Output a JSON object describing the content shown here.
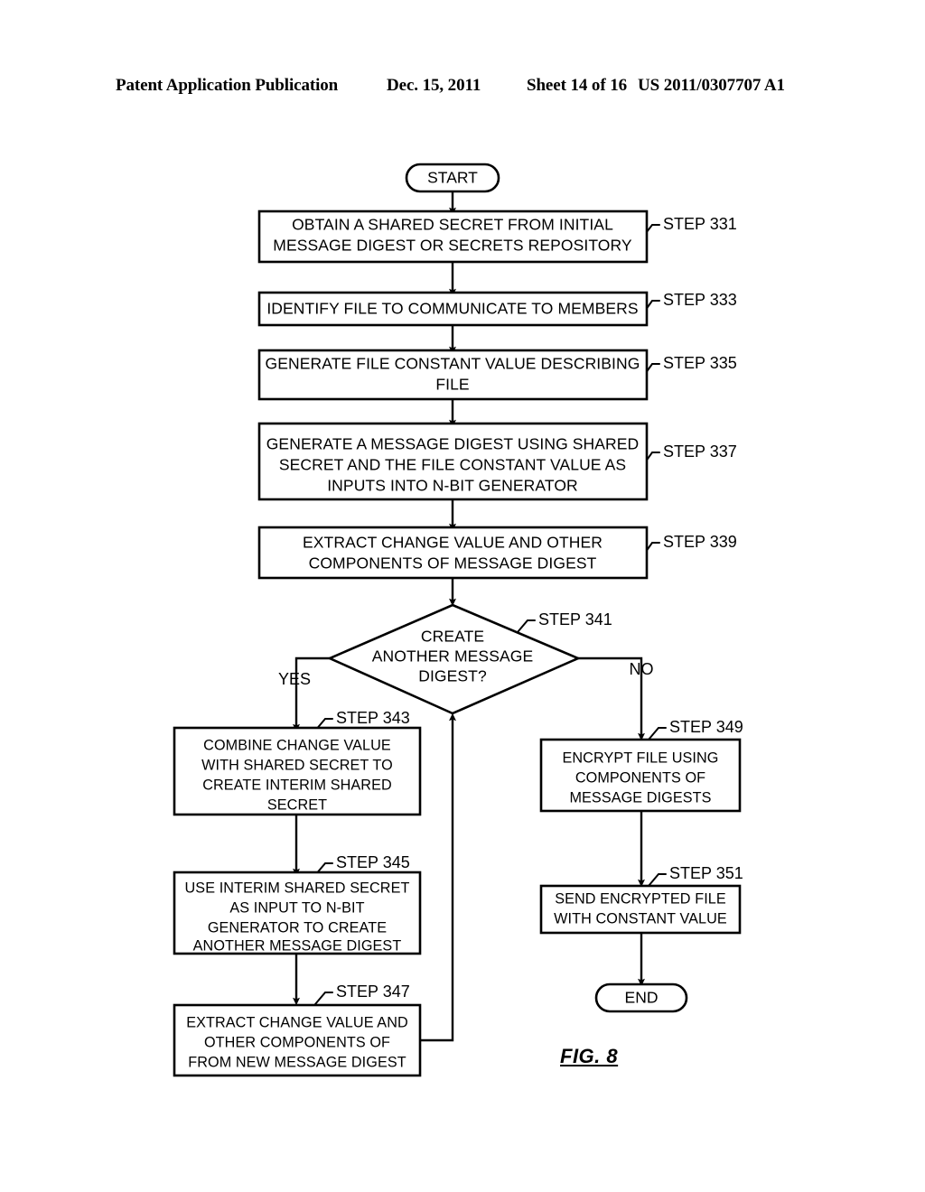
{
  "header": {
    "publication": "Patent Application Publication",
    "date": "Dec. 15, 2011",
    "sheet": "Sheet 14 of 16",
    "patent_number": "US 2011/0307707 A1"
  },
  "figure": {
    "caption": "FIG. 8"
  },
  "chart_data": {
    "type": "diagram",
    "title": "FIG. 8",
    "diagram_kind": "flowchart",
    "nodes": [
      {
        "id": "start",
        "kind": "terminal",
        "text": "START"
      },
      {
        "id": "step331",
        "kind": "process",
        "step": "STEP 331",
        "text": "OBTAIN A SHARED SECRET FROM INITIAL MESSAGE DIGEST OR SECRETS REPOSITORY"
      },
      {
        "id": "step333",
        "kind": "process",
        "step": "STEP 333",
        "text": "IDENTIFY FILE TO COMMUNICATE TO MEMBERS"
      },
      {
        "id": "step335",
        "kind": "process",
        "step": "STEP 335",
        "text": "GENERATE FILE CONSTANT VALUE DESCRIBING FILE"
      },
      {
        "id": "step337",
        "kind": "process",
        "step": "STEP 337",
        "text": "GENERATE A MESSAGE DIGEST USING SHARED SECRET AND THE FILE CONSTANT VALUE AS INPUTS INTO N-BIT GENERATOR"
      },
      {
        "id": "step339",
        "kind": "process",
        "step": "STEP 339",
        "text": "EXTRACT CHANGE VALUE AND OTHER COMPONENTS OF MESSAGE DIGEST"
      },
      {
        "id": "step341",
        "kind": "decision",
        "step": "STEP 341",
        "text": "CREATE ANOTHER MESSAGE DIGEST?"
      },
      {
        "id": "step343",
        "kind": "process",
        "step": "STEP 343",
        "text": "COMBINE CHANGE VALUE WITH SHARED SECRET TO CREATE INTERIM SHARED SECRET"
      },
      {
        "id": "step345",
        "kind": "process",
        "step": "STEP 345",
        "text": "USE INTERIM SHARED SECRET AS INPUT TO N-BIT GENERATOR TO CREATE ANOTHER MESSAGE DIGEST"
      },
      {
        "id": "step347",
        "kind": "process",
        "step": "STEP 347",
        "text": "EXTRACT CHANGE VALUE AND OTHER COMPONENTS OF FROM NEW MESSAGE DIGEST"
      },
      {
        "id": "step349",
        "kind": "process",
        "step": "STEP 349",
        "text": "ENCRYPT FILE USING COMPONENTS OF MESSAGE DIGESTS"
      },
      {
        "id": "step351",
        "kind": "process",
        "step": "STEP 351",
        "text": "SEND ENCRYPTED FILE WITH CONSTANT VALUE"
      },
      {
        "id": "end",
        "kind": "terminal",
        "text": "END"
      }
    ],
    "edges": [
      {
        "from": "start",
        "to": "step331",
        "label": ""
      },
      {
        "from": "step331",
        "to": "step333",
        "label": ""
      },
      {
        "from": "step333",
        "to": "step335",
        "label": ""
      },
      {
        "from": "step335",
        "to": "step337",
        "label": ""
      },
      {
        "from": "step337",
        "to": "step339",
        "label": ""
      },
      {
        "from": "step339",
        "to": "step341",
        "label": ""
      },
      {
        "from": "step341",
        "to": "step343",
        "label": "YES"
      },
      {
        "from": "step341",
        "to": "step349",
        "label": "NO"
      },
      {
        "from": "step343",
        "to": "step345",
        "label": ""
      },
      {
        "from": "step345",
        "to": "step347",
        "label": ""
      },
      {
        "from": "step347",
        "to": "step341",
        "label": ""
      },
      {
        "from": "step349",
        "to": "step351",
        "label": ""
      },
      {
        "from": "step351",
        "to": "end",
        "label": ""
      }
    ]
  },
  "nodes": {
    "start": {
      "text": "START"
    },
    "end": {
      "text": "END"
    },
    "step331": {
      "step": "STEP 331",
      "lines": [
        "OBTAIN A SHARED SECRET FROM INITIAL",
        "MESSAGE DIGEST OR SECRETS REPOSITORY"
      ]
    },
    "step333": {
      "step": "STEP 333",
      "lines": [
        "IDENTIFY FILE TO COMMUNICATE TO MEMBERS"
      ]
    },
    "step335": {
      "step": "STEP 335",
      "lines": [
        "GENERATE FILE CONSTANT VALUE DESCRIBING",
        "FILE"
      ]
    },
    "step337": {
      "step": "STEP 337",
      "lines": [
        "GENERATE A MESSAGE DIGEST USING SHARED",
        "SECRET AND THE FILE CONSTANT VALUE AS",
        "INPUTS INTO N-BIT GENERATOR"
      ]
    },
    "step339": {
      "step": "STEP 339",
      "lines": [
        "EXTRACT CHANGE VALUE AND OTHER",
        "COMPONENTS OF MESSAGE DIGEST"
      ]
    },
    "step341": {
      "step": "STEP 341",
      "lines": [
        "CREATE",
        "ANOTHER MESSAGE",
        "DIGEST?"
      ],
      "yes": "YES",
      "no": "NO"
    },
    "step343": {
      "step": "STEP 343",
      "lines": [
        "COMBINE CHANGE VALUE",
        "WITH SHARED SECRET TO",
        "CREATE INTERIM SHARED",
        "SECRET"
      ]
    },
    "step345": {
      "step": "STEP 345",
      "lines": [
        "USE INTERIM SHARED SECRET",
        "AS INPUT TO N-BIT",
        "GENERATOR TO CREATE",
        "ANOTHER MESSAGE DIGEST"
      ]
    },
    "step347": {
      "step": "STEP 347",
      "lines": [
        "EXTRACT CHANGE VALUE AND",
        "OTHER COMPONENTS OF",
        "FROM NEW MESSAGE DIGEST"
      ]
    },
    "step349": {
      "step": "STEP 349",
      "lines": [
        "ENCRYPT FILE USING",
        "COMPONENTS OF",
        "MESSAGE DIGESTS"
      ]
    },
    "step351": {
      "step": "STEP 351",
      "lines": [
        "SEND ENCRYPTED FILE",
        "WITH CONSTANT VALUE"
      ]
    }
  },
  "colors": {
    "ink": "#000000",
    "paper": "#ffffff"
  }
}
